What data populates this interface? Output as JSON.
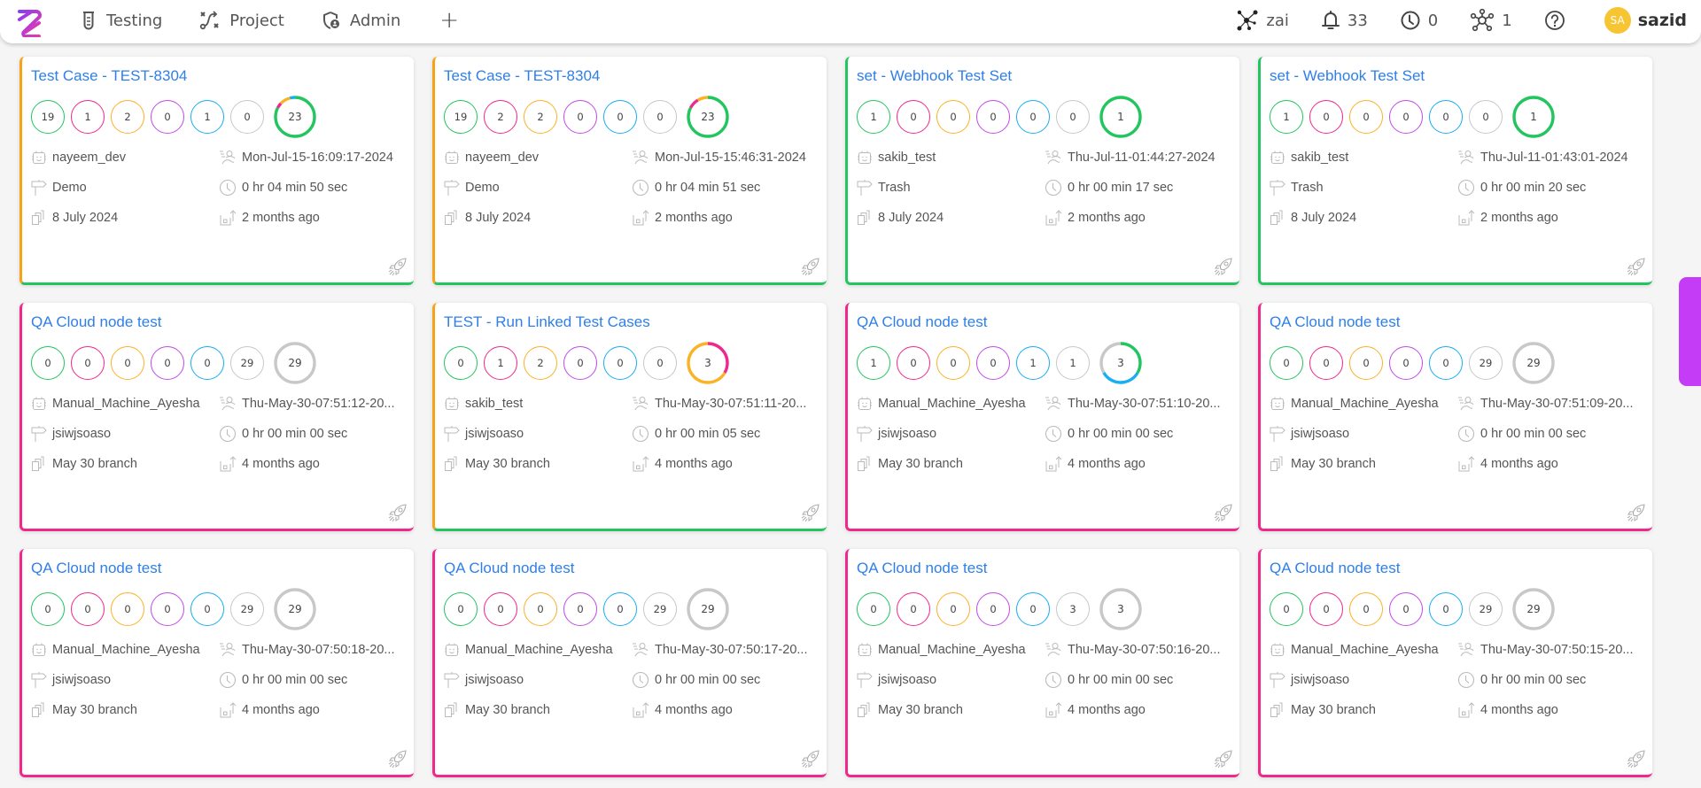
{
  "header": {
    "nav": [
      {
        "label": "Testing",
        "icon": "test-tube-icon"
      },
      {
        "label": "Project",
        "icon": "route-icon"
      },
      {
        "label": "Admin",
        "icon": "shield-user-icon"
      }
    ],
    "add_label": "+",
    "tools": {
      "workspace": {
        "label": "zai",
        "icon": "network-icon"
      },
      "notifications": {
        "count": "33",
        "icon": "bell-icon"
      },
      "pending": {
        "count": "0",
        "icon": "clock-icon"
      },
      "integrations": {
        "count": "1",
        "icon": "hub-icon"
      },
      "help": {
        "icon": "help-icon"
      }
    },
    "user": {
      "initials": "SA",
      "name": "sazid"
    }
  },
  "status_colors": {
    "passed": "#22c55e",
    "failed": "#f0288c",
    "blocked": "#fbb226",
    "skipped": "#c04be8",
    "retest": "#18aef2",
    "untested": "#c8c8c8"
  },
  "cards": [
    {
      "title": "Test Case - TEST-8304",
      "left": "#f7a318",
      "bottom": "#22c55e",
      "stats": [
        19,
        1,
        2,
        0,
        1,
        0
      ],
      "total": "23",
      "user": "nayeem_dev",
      "date": "Mon-Jul-15-16:09:17-2024",
      "project": "Demo",
      "duration": "0 hr 04 min 50 sec",
      "branch": "8 July 2024",
      "ago": "2 months ago"
    },
    {
      "title": "Test Case - TEST-8304",
      "left": "#f7a318",
      "bottom": "#22c55e",
      "stats": [
        19,
        2,
        2,
        0,
        0,
        0
      ],
      "total": "23",
      "user": "nayeem_dev",
      "date": "Mon-Jul-15-15:46:31-2024",
      "project": "Demo",
      "duration": "0 hr 04 min 51 sec",
      "branch": "8 July 2024",
      "ago": "2 months ago"
    },
    {
      "title": "set - Webhook Test Set",
      "left": "#22c55e",
      "bottom": "#22c55e",
      "stats": [
        1,
        0,
        0,
        0,
        0,
        0
      ],
      "total": "1",
      "user": "sakib_test",
      "date": "Thu-Jul-11-01:44:27-2024",
      "project": "Trash",
      "duration": "0 hr 00 min 17 sec",
      "branch": "8 July 2024",
      "ago": "2 months ago"
    },
    {
      "title": "set - Webhook Test Set",
      "left": "#22c55e",
      "bottom": "#22c55e",
      "stats": [
        1,
        0,
        0,
        0,
        0,
        0
      ],
      "total": "1",
      "user": "sakib_test",
      "date": "Thu-Jul-11-01:43:01-2024",
      "project": "Trash",
      "duration": "0 hr 00 min 20 sec",
      "branch": "8 July 2024",
      "ago": "2 months ago"
    },
    {
      "title": "QA Cloud node test",
      "left": "#f0288c",
      "bottom": "#f0288c",
      "stats": [
        0,
        0,
        0,
        0,
        0,
        29
      ],
      "total": "29",
      "user": "Manual_Machine_Ayesha",
      "date": "Thu-May-30-07:51:12-20...",
      "project": "jsiwjsoaso",
      "duration": "0 hr 00 min 00 sec",
      "branch": "May 30 branch",
      "ago": "4 months ago"
    },
    {
      "title": "TEST - Run Linked Test Cases",
      "left": "#f7a318",
      "bottom": "#22c55e",
      "stats": [
        0,
        1,
        2,
        0,
        0,
        0
      ],
      "total": "3",
      "user": "sakib_test",
      "date": "Thu-May-30-07:51:11-20...",
      "project": "jsiwjsoaso",
      "duration": "0 hr 00 min 05 sec",
      "branch": "May 30 branch",
      "ago": "4 months ago"
    },
    {
      "title": "QA Cloud node test",
      "left": "#f0288c",
      "bottom": "#f0288c",
      "stats": [
        1,
        0,
        0,
        0,
        1,
        1
      ],
      "total": "3",
      "user": "Manual_Machine_Ayesha",
      "date": "Thu-May-30-07:51:10-20...",
      "project": "jsiwjsoaso",
      "duration": "0 hr 00 min 00 sec",
      "branch": "May 30 branch",
      "ago": "4 months ago"
    },
    {
      "title": "QA Cloud node test",
      "left": "#f0288c",
      "bottom": "#f0288c",
      "stats": [
        0,
        0,
        0,
        0,
        0,
        29
      ],
      "total": "29",
      "user": "Manual_Machine_Ayesha",
      "date": "Thu-May-30-07:51:09-20...",
      "project": "jsiwjsoaso",
      "duration": "0 hr 00 min 00 sec",
      "branch": "May 30 branch",
      "ago": "4 months ago"
    },
    {
      "title": "QA Cloud node test",
      "left": "#f0288c",
      "bottom": "#f0288c",
      "stats": [
        0,
        0,
        0,
        0,
        0,
        29
      ],
      "total": "29",
      "user": "Manual_Machine_Ayesha",
      "date": "Thu-May-30-07:50:18-20...",
      "project": "jsiwjsoaso",
      "duration": "0 hr 00 min 00 sec",
      "branch": "May 30 branch",
      "ago": "4 months ago"
    },
    {
      "title": "QA Cloud node test",
      "left": "#f0288c",
      "bottom": "#f0288c",
      "stats": [
        0,
        0,
        0,
        0,
        0,
        29
      ],
      "total": "29",
      "user": "Manual_Machine_Ayesha",
      "date": "Thu-May-30-07:50:17-20...",
      "project": "jsiwjsoaso",
      "duration": "0 hr 00 min 00 sec",
      "branch": "May 30 branch",
      "ago": "4 months ago"
    },
    {
      "title": "QA Cloud node test",
      "left": "#f0288c",
      "bottom": "#f0288c",
      "stats": [
        0,
        0,
        0,
        0,
        0,
        3
      ],
      "total": "3",
      "user": "Manual_Machine_Ayesha",
      "date": "Thu-May-30-07:50:16-20...",
      "project": "jsiwjsoaso",
      "duration": "0 hr 00 min 00 sec",
      "branch": "May 30 branch",
      "ago": "4 months ago"
    },
    {
      "title": "QA Cloud node test",
      "left": "#f0288c",
      "bottom": "#f0288c",
      "stats": [
        0,
        0,
        0,
        0,
        0,
        29
      ],
      "total": "29",
      "user": "Manual_Machine_Ayesha",
      "date": "Thu-May-30-07:50:15-20...",
      "project": "jsiwjsoaso",
      "duration": "0 hr 00 min 00 sec",
      "branch": "May 30 branch",
      "ago": "4 months ago"
    }
  ]
}
